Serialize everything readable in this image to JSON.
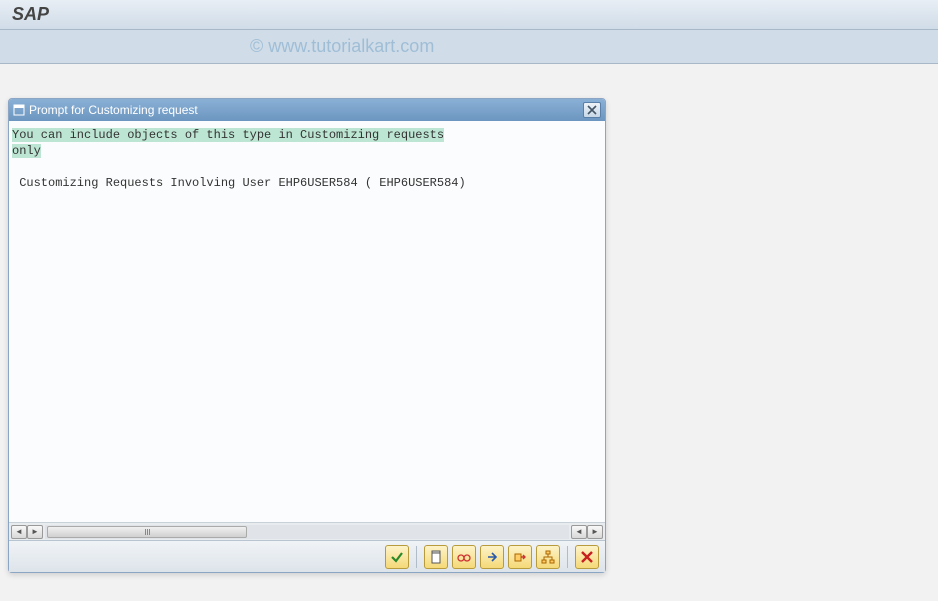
{
  "header": {
    "title": "SAP",
    "watermark": "© www.tutorialkart.com"
  },
  "dialog": {
    "title": "Prompt for Customizing request",
    "message_highlight_line1": "You can include objects of this type in Customizing requests",
    "message_highlight_line2": "only",
    "detail_line": " Customizing Requests Involving User EHP6USER584 ( EHP6USER584)"
  },
  "toolbar": {
    "accept": "Continue",
    "new": "Create Request",
    "own": "Own Requests",
    "next": "Next",
    "last": "Last",
    "tree": "Tree",
    "cancel": "Cancel"
  }
}
